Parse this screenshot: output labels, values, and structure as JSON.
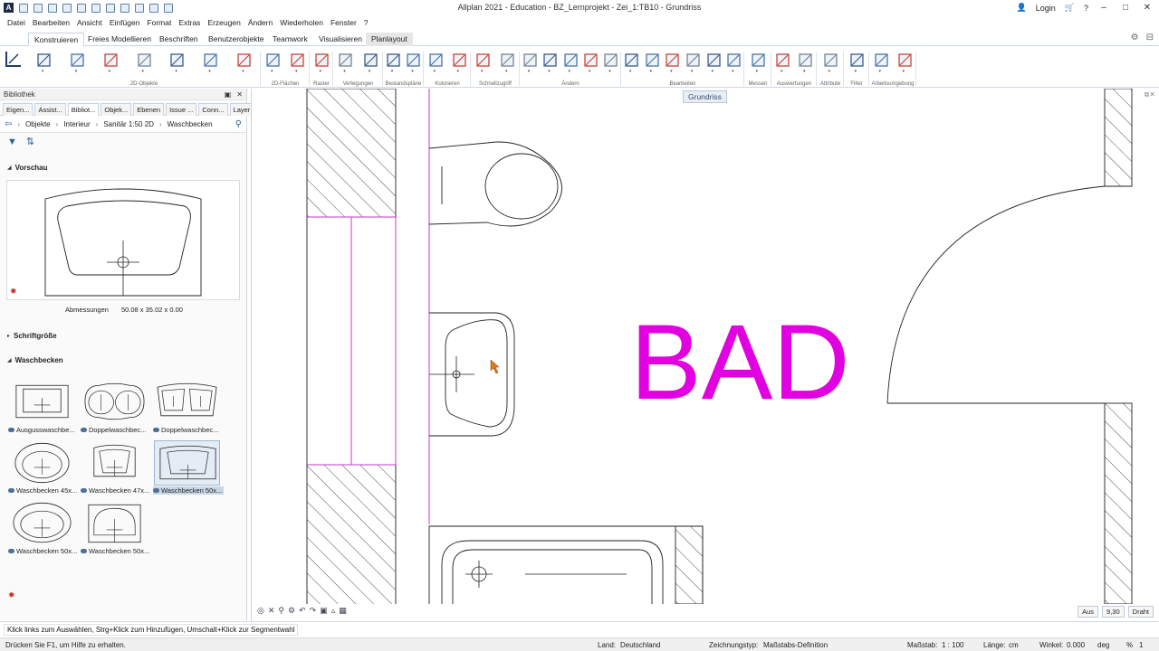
{
  "window": {
    "title": "Allplan 2021 - Education - BZ_Lernprojekt - Zei_1:TB10 - Grundriss",
    "app_icon": "A",
    "login_label": "Login"
  },
  "menu": [
    "Datei",
    "Bearbeiten",
    "Ansicht",
    "Einfügen",
    "Format",
    "Extras",
    "Erzeugen",
    "Ändern",
    "Wiederholen",
    "Fenster",
    "?"
  ],
  "ribbon": {
    "tabs": [
      "Konstruieren",
      "Freies Modellieren",
      "Beschriften",
      "Benutzerobjekte",
      "Teamwork",
      "Visualisieren",
      "Planlayout"
    ],
    "active_tab": "Konstruieren",
    "groups": [
      "2D-Objekte",
      "2D-Flächen",
      "Raster",
      "Verlegungen",
      "Bestandspläne",
      "Kolorieren",
      "Schnellzugriff",
      "Ändern",
      "Bearbeiten",
      "Messen",
      "Auswertungen",
      "Attribute",
      "Filter",
      "Arbeitsumgebung"
    ]
  },
  "library": {
    "title": "Bibliothek",
    "tabs": [
      "Eigen...",
      "Assist...",
      "Bibliot...",
      "Objek...",
      "Ebenen",
      "Issue ...",
      "Conn...",
      "Layer"
    ],
    "active_tab": "Bibliot...",
    "breadcrumb": [
      "Objekte",
      "Interieur",
      "Sanitär 1:50 2D",
      "Waschbecken"
    ],
    "preview_title": "Vorschau",
    "dimensions_label": "Abmessungen",
    "dimensions_value": "50.08 x 35.02 x 0.00",
    "font_section": "Schriftgröße",
    "category": "Waschbecken",
    "items": [
      {
        "label": "Ausgusswaschbe..."
      },
      {
        "label": "Doppelwaschbec..."
      },
      {
        "label": "Doppelwaschbec..."
      },
      {
        "label": "Waschbecken 45x..."
      },
      {
        "label": "Waschbecken 47x..."
      },
      {
        "label": "Waschbecken 50x..."
      },
      {
        "label": "Waschbecken 50x..."
      },
      {
        "label": "Waschbecken 50x..."
      }
    ],
    "selected_index": 5
  },
  "canvas": {
    "view_label": "Grundriss",
    "room_label": "BAD",
    "room_label_color": "#e000e0",
    "wall_color": "#222222",
    "magenta_line_color": "#cc33cc",
    "bottom_controls": {
      "aus": "Aus",
      "scale": "9,30",
      "mode": "Draht"
    }
  },
  "hint": "Klick links zum Auswählen, Strg+Klick zum Hinzufügen, Umschalt+Klick zur Segmentwahl",
  "status": {
    "help": "Drücken Sie F1, um Hilfe zu erhalten.",
    "land_label": "Land:",
    "land_value": "Deutschland",
    "zeichnungstyp_label": "Zeichnungstyp:",
    "zeichnungstyp_value": "Maßstabs-Definition",
    "massstab_label": "Maßstab:",
    "massstab_value": "1 : 100",
    "laenge_label": "Länge:",
    "laenge_value": "cm",
    "winkel_label": "Winkel:",
    "winkel_value": "0.000",
    "winkel_unit": "deg",
    "percent_label": "%",
    "percent_value": "1"
  }
}
